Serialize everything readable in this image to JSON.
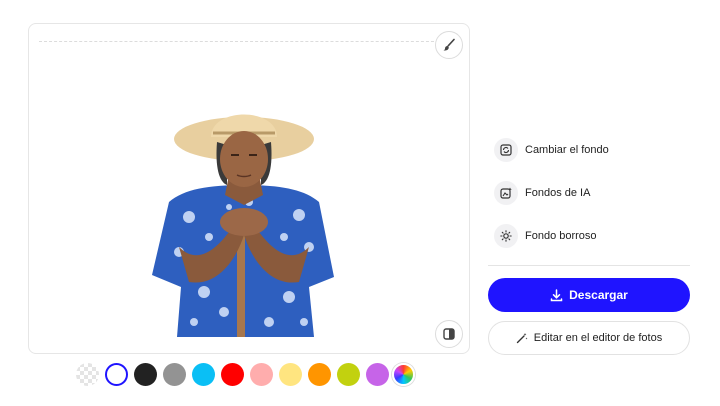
{
  "canvas": {
    "brush_icon": "brush-icon",
    "compare_icon": "compare-icon"
  },
  "swatches": [
    {
      "name": "transparent",
      "color": "transparent"
    },
    {
      "name": "white",
      "color": "#ffffff",
      "selected": true
    },
    {
      "name": "black",
      "color": "#222222"
    },
    {
      "name": "gray",
      "color": "#939393"
    },
    {
      "name": "sky-blue",
      "color": "#0abff5"
    },
    {
      "name": "red",
      "color": "#ff0000"
    },
    {
      "name": "pink",
      "color": "#ffadad"
    },
    {
      "name": "light-yellow",
      "color": "#ffe580"
    },
    {
      "name": "orange",
      "color": "#ff9500"
    },
    {
      "name": "lime",
      "color": "#c2d10f"
    },
    {
      "name": "purple",
      "color": "#c664e8"
    },
    {
      "name": "custom-color",
      "color": "rainbow"
    }
  ],
  "options": [
    {
      "label": "Cambiar el fondo",
      "icon": "change-background-icon"
    },
    {
      "label": "Fondos de IA",
      "icon": "ai-backgrounds-icon"
    },
    {
      "label": "Fondo borroso",
      "icon": "blur-background-icon"
    }
  ],
  "actions": {
    "download_label": "Descargar",
    "edit_label": "Editar en el editor de fotos"
  },
  "colors": {
    "accent": "#1f14ff"
  }
}
